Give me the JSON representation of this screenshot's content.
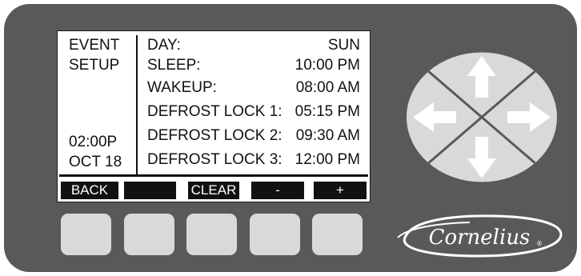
{
  "screen": {
    "left_labels": [
      "EVENT",
      "SETUP"
    ],
    "time": "02:00P",
    "date": "OCT 18",
    "rows": [
      {
        "label": "DAY:",
        "value": "SUN"
      },
      {
        "label": "SLEEP:",
        "value": "10:00 PM"
      },
      {
        "label": "WAKEUP:",
        "value": "08:00 AM"
      },
      {
        "label": "DEFROST LOCK 1:",
        "value": "05:15 PM"
      },
      {
        "label": "DEFROST LOCK 2:",
        "value": "09:30 AM"
      },
      {
        "label": "DEFROST LOCK 3:",
        "value": "12:00 PM"
      }
    ],
    "softkeys": [
      "BACK",
      "",
      "CLEAR",
      "-",
      "+"
    ]
  },
  "brand": {
    "logo_text": "Cornelius",
    "registered_mark": "®"
  },
  "colors": {
    "panel": "#595959",
    "button": "#d9d9d9",
    "dpad": "#d9d9d9",
    "lcd_ink": "#111111"
  },
  "icons": {
    "up": "arrow-up-icon",
    "down": "arrow-down-icon",
    "left": "arrow-left-icon",
    "right": "arrow-right-icon"
  }
}
